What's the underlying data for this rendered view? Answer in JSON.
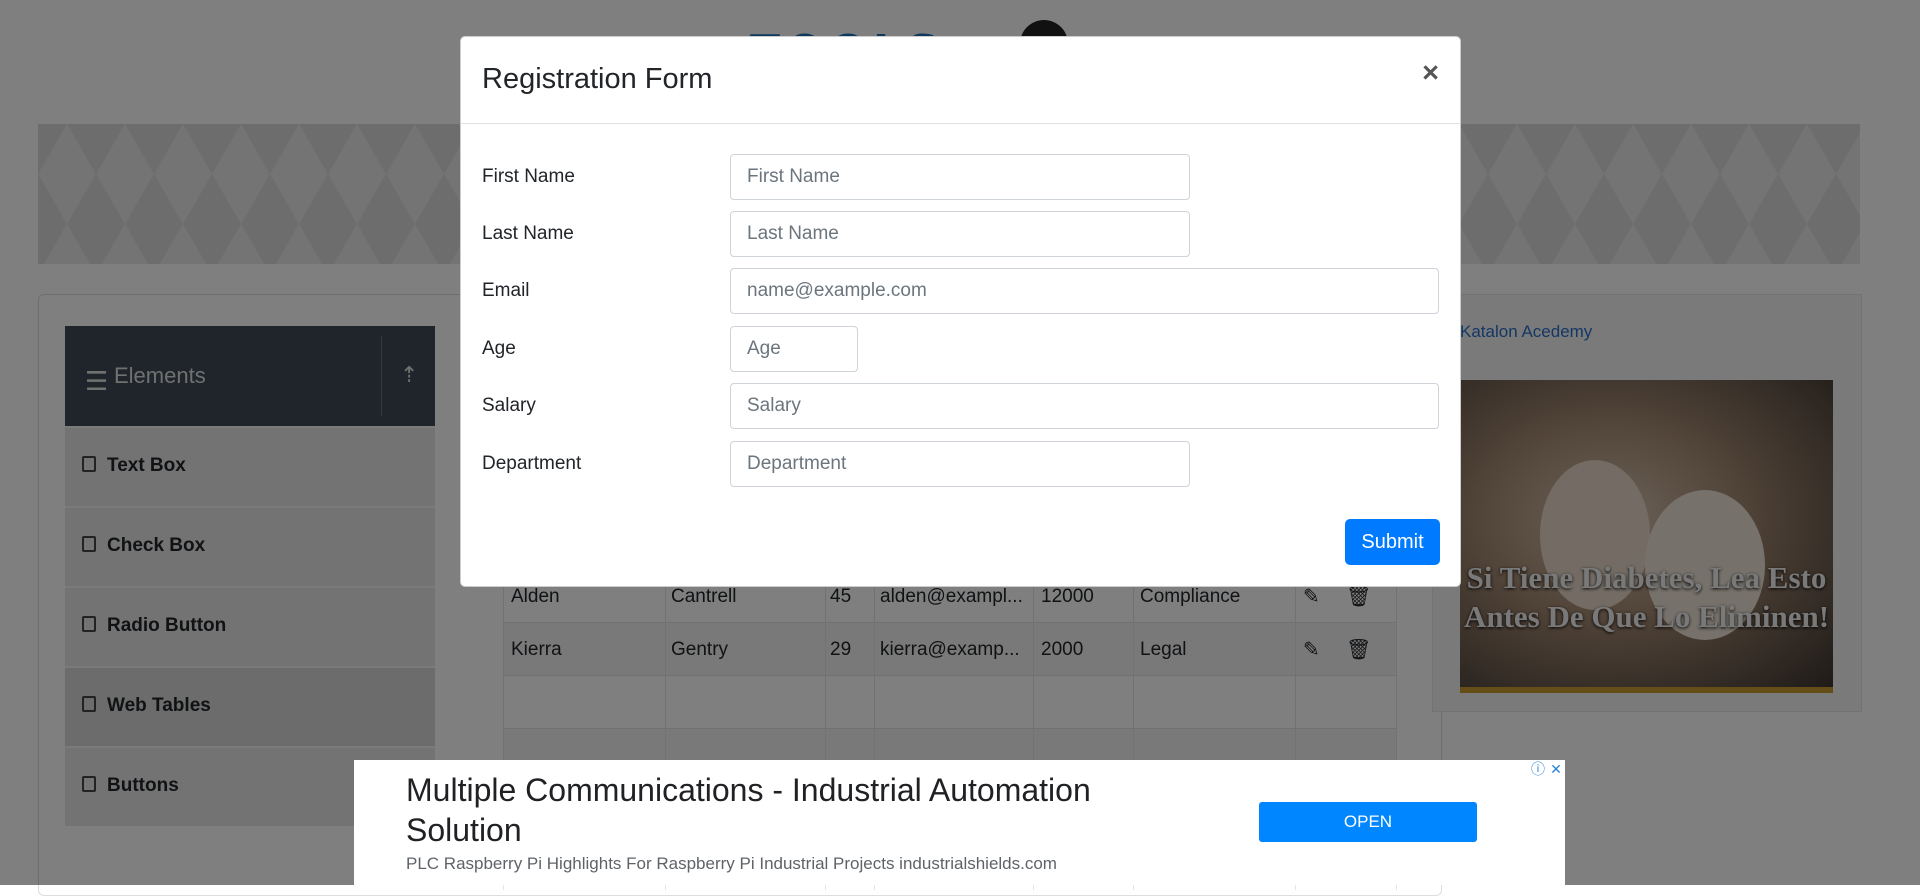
{
  "logo_text": "TOOLS",
  "sidebar": {
    "header": "Elements",
    "items": [
      {
        "label": "Text Box"
      },
      {
        "label": "Check Box"
      },
      {
        "label": "Radio Button"
      },
      {
        "label": "Web Tables"
      },
      {
        "label": "Buttons"
      }
    ]
  },
  "table": {
    "rows": [
      {
        "first": "Alden",
        "last": "Cantrell",
        "age": "45",
        "email": "alden@exampl...",
        "salary": "12000",
        "department": "Compliance"
      },
      {
        "first": "Kierra",
        "last": "Gentry",
        "age": "29",
        "email": "kierra@examp...",
        "salary": "2000",
        "department": "Legal"
      }
    ]
  },
  "side_ad": {
    "link_text": "Katalon Acedemy",
    "caption": "Si Tiene Diabetes, Lea Esto Antes De Que Lo Eliminen!"
  },
  "modal": {
    "title": "Registration Form",
    "close": "×",
    "fields": [
      {
        "label": "First Name",
        "placeholder": "First Name"
      },
      {
        "label": "Last Name",
        "placeholder": "Last Name"
      },
      {
        "label": "Email",
        "placeholder": "name@example.com"
      },
      {
        "label": "Age",
        "placeholder": "Age"
      },
      {
        "label": "Salary",
        "placeholder": "Salary"
      },
      {
        "label": "Department",
        "placeholder": "Department"
      }
    ],
    "submit": "Submit"
  },
  "bottom_ad": {
    "headline": "Multiple Communications - Industrial Automation Solution",
    "subline": "PLC Raspberry Pi Highlights For Raspberry Pi Industrial Projects industrialshields.com",
    "cta": "OPEN",
    "info_icon": "ⓘ",
    "close_icon": "✕"
  },
  "colors": {
    "primary": "#007bff",
    "sidebar_header": "#3f4a55",
    "overlay": "rgba(0,0,0,0.5)"
  }
}
